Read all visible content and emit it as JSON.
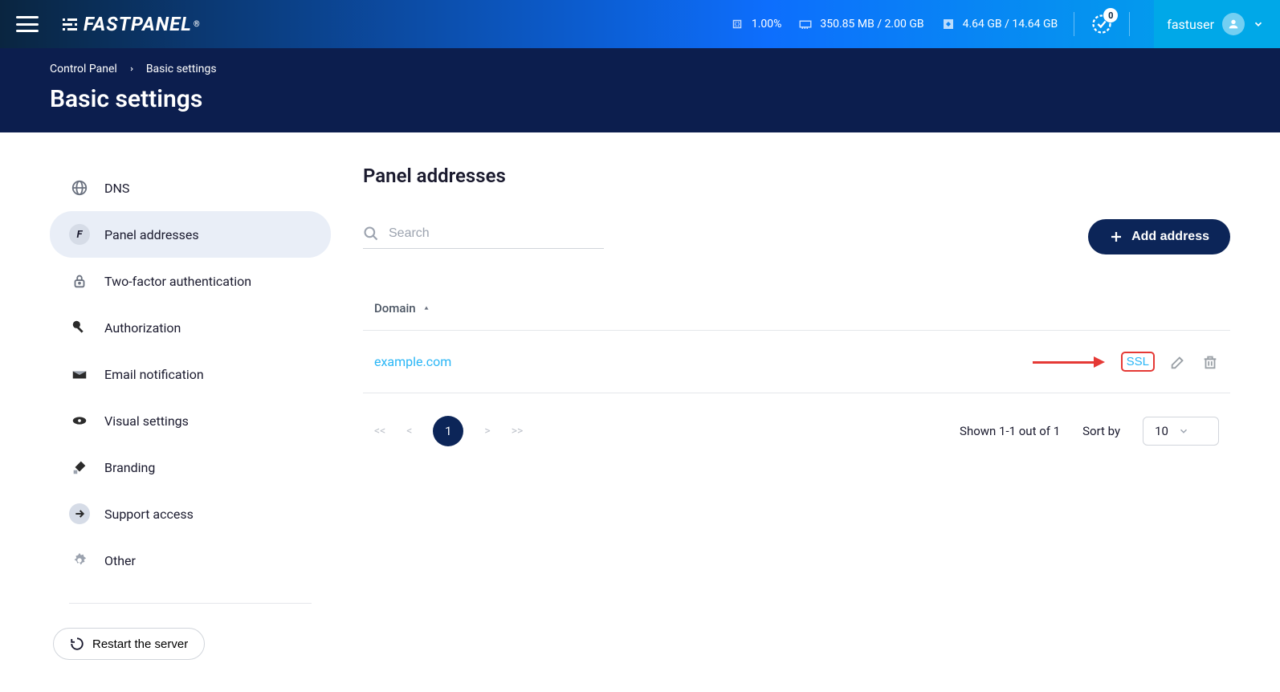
{
  "header": {
    "logo": "FASTPANEL",
    "cpu": "1.00%",
    "memory": "350.85 MB / 2.00 GB",
    "disk": "4.64 GB / 14.64 GB",
    "notifications": "0",
    "username": "fastuser"
  },
  "breadcrumb": {
    "root": "Control Panel",
    "current": "Basic settings"
  },
  "page_title": "Basic settings",
  "sidebar": {
    "items": [
      {
        "label": "DNS"
      },
      {
        "label": "Panel addresses"
      },
      {
        "label": "Two-factor authentication"
      },
      {
        "label": "Authorization"
      },
      {
        "label": "Email notification"
      },
      {
        "label": "Visual settings"
      },
      {
        "label": "Branding"
      },
      {
        "label": "Support access"
      },
      {
        "label": "Other"
      }
    ],
    "restart": "Restart the server"
  },
  "content": {
    "title": "Panel addresses",
    "search_placeholder": "Search",
    "add_button": "Add address",
    "column_domain": "Domain",
    "rows": [
      {
        "domain": "example.com",
        "ssl_label": "SSL"
      }
    ],
    "pagination": {
      "first": "<<",
      "prev": "<",
      "current": "1",
      "next": ">",
      "last": ">>",
      "shown": "Shown 1-1 out of 1",
      "sort_by": "Sort by",
      "per_page": "10"
    }
  }
}
